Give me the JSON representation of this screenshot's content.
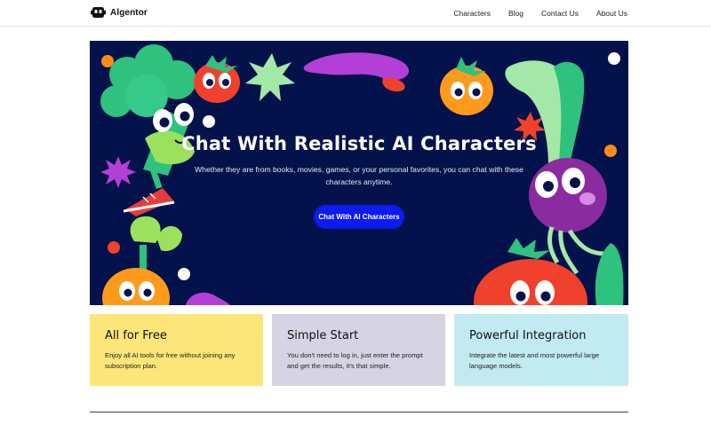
{
  "brand": {
    "name": "Algentor",
    "icon": "robot-face-icon"
  },
  "nav": {
    "items": [
      {
        "label": "Characters"
      },
      {
        "label": "Blog"
      },
      {
        "label": "Contact Us"
      },
      {
        "label": "About Us"
      }
    ]
  },
  "hero": {
    "title": "Chat With Realistic AI Characters",
    "subtitle": "Whether they are from books, movies, games, or your personal favorites, you can chat with these characters anytime.",
    "cta_label": "Chat With AI Characters",
    "colors": {
      "background": "#03124a",
      "cta": "#0c1bf0"
    }
  },
  "features": [
    {
      "title": "All for Free",
      "body": "Enjoy all AI tools for free without joining any subscription plan.",
      "color": "#fde679"
    },
    {
      "title": "Simple Start",
      "body": "You don't need to log in, just enter the prompt and get the results, it's that simple.",
      "color": "#d6d4e4"
    },
    {
      "title": "Powerful Integration",
      "body": "Integrate the latest and most powerful large language models.",
      "color": "#c2eaf1"
    }
  ]
}
